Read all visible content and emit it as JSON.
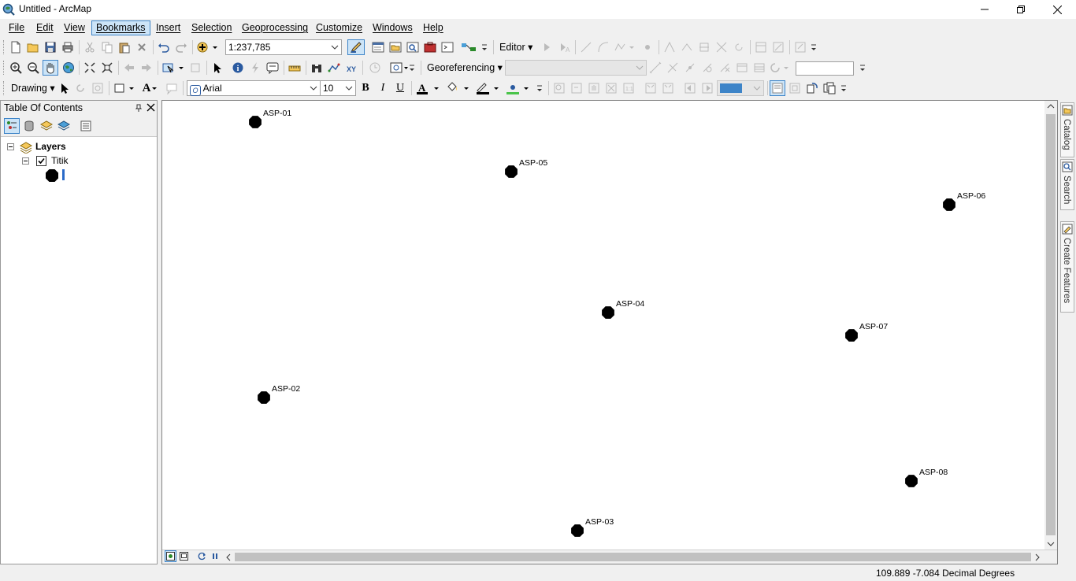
{
  "window": {
    "title": "Untitled - ArcMap"
  },
  "menu": [
    {
      "label": "File"
    },
    {
      "label": "Edit"
    },
    {
      "label": "View"
    },
    {
      "label": "Bookmarks",
      "active": true
    },
    {
      "label": "Insert"
    },
    {
      "label": "Selection"
    },
    {
      "label": "Geoprocessing"
    },
    {
      "label": "Customize"
    },
    {
      "label": "Windows"
    },
    {
      "label": "Help"
    }
  ],
  "standard_toolbar": {
    "scale": "1:237,785",
    "editor_label": "Editor"
  },
  "tools_toolbar": {
    "georeferencing_label": "Georeferencing"
  },
  "draw_toolbar": {
    "drawing_label": "Drawing",
    "font": "Arial",
    "font_size": "10",
    "bold": "B",
    "italic": "I",
    "underline": "U",
    "text_tool": "A"
  },
  "toc": {
    "title": "Table Of Contents",
    "root": "Layers",
    "layer": "Titik",
    "layer_checked": true
  },
  "map": {
    "points": [
      {
        "label": "ASP-01"
      },
      {
        "label": "ASP-05"
      },
      {
        "label": "ASP-06"
      },
      {
        "label": "ASP-04"
      },
      {
        "label": "ASP-07"
      },
      {
        "label": "ASP-02"
      },
      {
        "label": "ASP-08"
      },
      {
        "label": "ASP-03"
      }
    ]
  },
  "dock": {
    "catalog": "Catalog",
    "search": "Search",
    "create_features": "Create Features"
  },
  "status": {
    "coords": "109.889  -7.084 Decimal Degrees"
  },
  "colors": {
    "accent": "#3d84c8",
    "accent_fill": "#cce4f7",
    "point": "#000000"
  }
}
